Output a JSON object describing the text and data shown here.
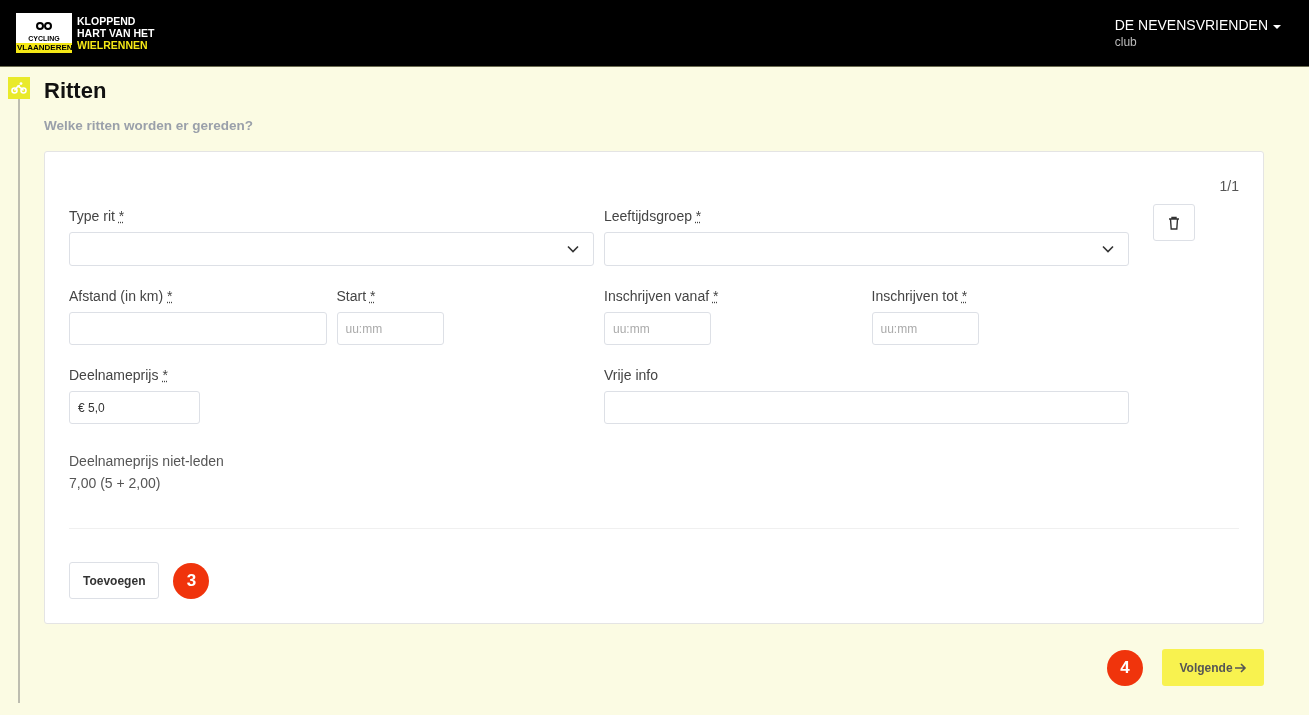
{
  "header": {
    "logo": {
      "badge_text": "CYCLING",
      "badge_subtext": "VLAANDEREN",
      "lines": [
        "KLOPPEND",
        "HART VAN HET"
      ],
      "highlight_line": "WIELRENNEN"
    },
    "account": {
      "name": "DE NEVENSVRIENDEN",
      "role": "club"
    }
  },
  "section": {
    "title": "Ritten",
    "subtitle": "Welke ritten worden er gereden?"
  },
  "ride_card": {
    "counter": "1/1",
    "rows": [
      [
        [
          {
            "kind": "select",
            "label": "Type rit",
            "required": true
          }
        ],
        [
          {
            "kind": "select",
            "label": "Leeftijdsgroep",
            "required": true
          }
        ]
      ],
      [
        [
          {
            "kind": "text",
            "label": "Afstand (in km)",
            "required": true
          },
          {
            "kind": "time",
            "label": "Start",
            "required": true,
            "placeholder": "uu:mm"
          }
        ],
        [
          {
            "kind": "time",
            "label": "Inschrijven vanaf",
            "required": true,
            "placeholder": "uu:mm"
          },
          {
            "kind": "time",
            "label": "Inschrijven tot",
            "required": true,
            "placeholder": "uu:mm"
          }
        ]
      ],
      [
        [
          {
            "kind": "money",
            "label": "Deelnameprijs",
            "required": true,
            "value": "€ 5,0"
          }
        ],
        [
          {
            "kind": "text",
            "label": "Vrije info",
            "required": false
          }
        ]
      ]
    ],
    "required_mark": "*",
    "info": {
      "label": "Deelnameprijs niet-leden",
      "value": "7,00 (5 + 2,00)"
    },
    "add_button": "Toevoegen",
    "add_step": "3"
  },
  "footer": {
    "next_button": "Volgende",
    "next_step": "4"
  }
}
